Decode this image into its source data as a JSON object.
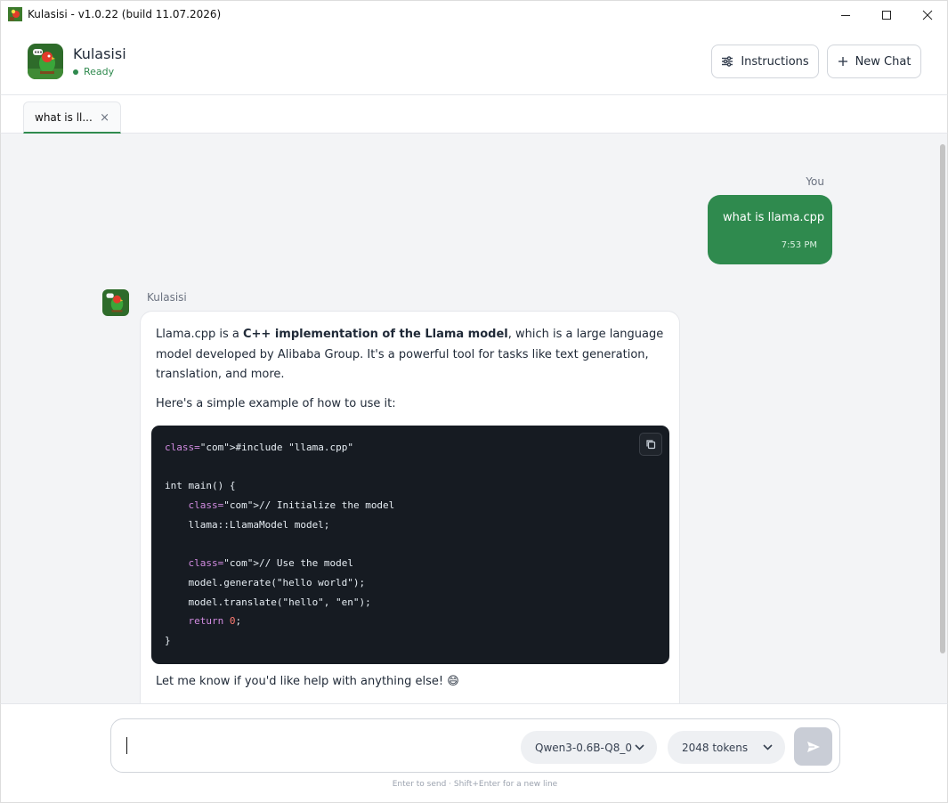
{
  "window": {
    "title": "Kulasisi - v1.0.22 (build 11.07.2026)"
  },
  "header": {
    "app_name": "Kulasisi",
    "status": "Ready",
    "instructions_label": "Instructions",
    "new_chat_label": "New Chat"
  },
  "tabs": [
    {
      "label": "what is ll...",
      "close": "×"
    }
  ],
  "chat": {
    "user": {
      "sender": "You",
      "text": "what is llama.cpp",
      "time": "7:53 PM"
    },
    "assistant": {
      "sender": "Kulasisi",
      "para1_pre": "Llama.cpp is a ",
      "para1_bold": "C++ implementation of the Llama model",
      "para1_post": ", which is a large language model developed by Alibaba Group. It's a powerful tool for tasks like text generation, translation, and more.",
      "para2": "Here's a simple example of how to use it:",
      "code_lines": [
        "class=\"com\">#include \"llama.cpp\"",
        "",
        "int main() {",
        "    class=\"com\">// Initialize the model",
        "    llama::LlamaModel model;",
        "",
        "    class=\"com\">// Use the model",
        "    model.generate(\"hello world\");",
        "    model.translate(\"hello\", \"en\");",
        "    return 0;",
        "}"
      ],
      "para3": "Let me know if you'd like help with anything else! 😄"
    }
  },
  "composer": {
    "input_value": "",
    "model": "Qwen3-0.6B-Q8_0",
    "tokens": "2048 tokens",
    "hint": "Enter to send  ·  Shift+Enter for a new line"
  },
  "colors": {
    "accent": "#2f8a4e",
    "code_bg": "#161b22",
    "chat_bg": "#f3f4f6"
  }
}
